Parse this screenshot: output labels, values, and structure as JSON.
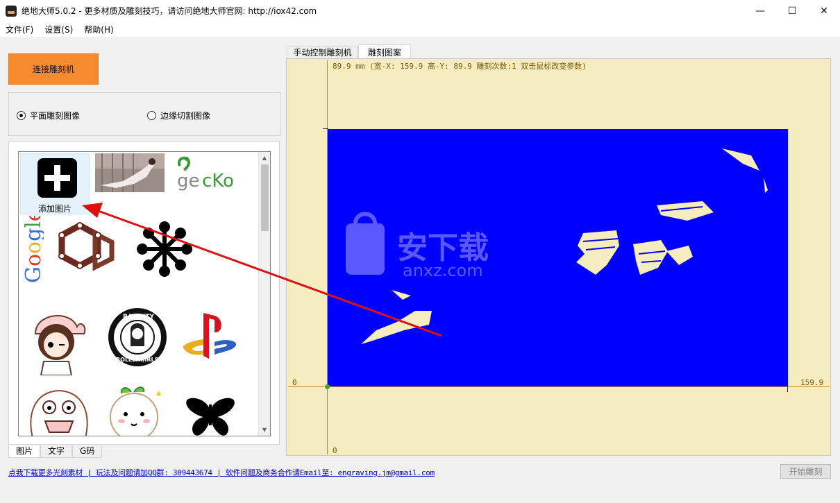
{
  "window": {
    "title": "绝地大师5.0.2 - 更多材质及雕刻技巧，请访问绝地大师官网: http://iox42.com",
    "minimize": "—",
    "maximize": "☐",
    "close": "✕"
  },
  "menu": [
    "文件(F)",
    "设置(S)",
    "帮助(H)"
  ],
  "connect_button": "连接雕刻机",
  "modes": {
    "flat": "平面雕刻图像",
    "edge": "边缘切割图像",
    "selected": "flat"
  },
  "library": {
    "add_label": "添加图片",
    "items": [
      {
        "icon": "add-image-icon"
      },
      {
        "icon": "photo-thumbnail"
      },
      {
        "icon": "gecko-logo",
        "text": "gecko"
      },
      {
        "icon": "google-logo",
        "text": "Google"
      },
      {
        "icon": "hexagon-ring-icon"
      },
      {
        "icon": "flower-dots-icon"
      },
      {
        "icon": "cartoon-girl"
      },
      {
        "icon": "rat-city-logo",
        "text": "RAT CITY ROLLERGIRLS"
      },
      {
        "icon": "playstation-logo"
      },
      {
        "icon": "cartoon-monster"
      },
      {
        "icon": "cartoon-fruit"
      },
      {
        "icon": "butterfly-icon"
      }
    ]
  },
  "bottom_tabs": [
    "图片",
    "文字",
    "G码"
  ],
  "footer_text": "点我下载更多光刻素材 | 玩法及问题请加QQ群: 309443674 | 软件问题及商务合作请Email至: engraving.jm@gmail.com",
  "start_button": "开始雕刻",
  "right_tabs": [
    "手动控制雕刻机",
    "雕刻图案"
  ],
  "canvas": {
    "info": "89.9 mm  (宽-X: 159.9  高-Y: 89.9  雕刻次数:1  双击鼠标改变参数)",
    "x_min_label": "0",
    "x_max_label": "159.9",
    "y_min_label": "0",
    "watermark_main": "安下载",
    "watermark_sub": "anxz.com"
  },
  "colors": {
    "connect_button": "#f58a2e",
    "canvas_bg": "#f5ecbf",
    "engrave_fill": "#0000ff",
    "annotation_arrow": "#e01010"
  }
}
